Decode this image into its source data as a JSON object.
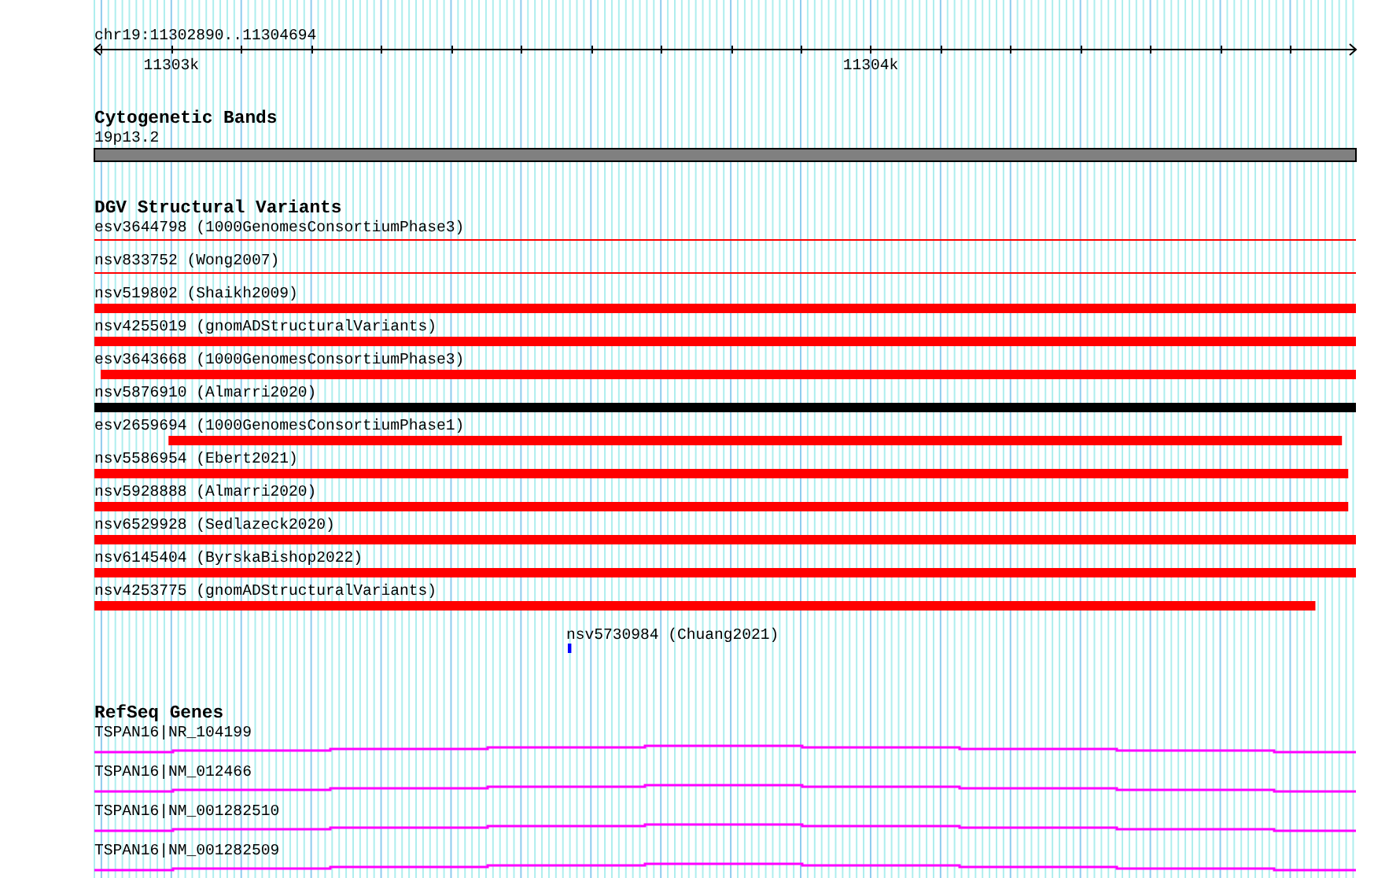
{
  "ruler": {
    "location": "chr19:11302890..11304694",
    "labels": [
      "11303k",
      "11304k"
    ]
  },
  "tracks": [
    {
      "kind": "bands",
      "title": "Cytogenetic Bands",
      "features": [
        {
          "label": "19p13.2",
          "color": "#808080"
        }
      ]
    },
    {
      "kind": "variants",
      "title": "DGV Structural Variants",
      "features": [
        {
          "label": "esv3644798 (1000GenomesConsortiumPhase3)",
          "kind": "thin",
          "color": "#ff0000"
        },
        {
          "label": "nsv833752 (Wong2007)",
          "kind": "thin",
          "color": "#ff0000"
        },
        {
          "label": "nsv519802 (Shaikh2009)",
          "kind": "thick",
          "color": "#ff0000"
        },
        {
          "label": "nsv4255019 (gnomADStructuralVariants)",
          "kind": "thick",
          "color": "#ff0000"
        },
        {
          "label": "esv3643668 (1000GenomesConsortiumPhase3)",
          "kind": "thick",
          "color": "#ff0000"
        },
        {
          "label": "nsv5876910 (Almarri2020)",
          "kind": "thick",
          "color": "#000000"
        },
        {
          "label": "esv2659694 (1000GenomesConsortiumPhase1)",
          "kind": "thick",
          "color": "#ff0000"
        },
        {
          "label": "nsv5586954 (Ebert2021)",
          "kind": "thick",
          "color": "#ff0000"
        },
        {
          "label": "nsv5928888 (Almarri2020)",
          "kind": "thick",
          "color": "#ff0000"
        },
        {
          "label": "nsv6529928 (Sedlazeck2020)",
          "kind": "thick",
          "color": "#ff0000"
        },
        {
          "label": "nsv6145404 (ByrskaBishop2022)",
          "kind": "thick",
          "color": "#ff0000"
        },
        {
          "label": "nsv4253775 (gnomADStructuralVariants)",
          "kind": "thick",
          "color": "#ff0000"
        },
        {
          "label": "nsv5730984 (Chuang2021)",
          "kind": "tick",
          "color": "#0000ff"
        }
      ]
    },
    {
      "kind": "genes",
      "title": "RefSeq Genes",
      "features": [
        {
          "label": "TSPAN16|NR_104199"
        },
        {
          "label": "TSPAN16|NM_012466"
        },
        {
          "label": "TSPAN16|NM_001282510"
        },
        {
          "label": "TSPAN16|NM_001282509"
        }
      ]
    }
  ]
}
